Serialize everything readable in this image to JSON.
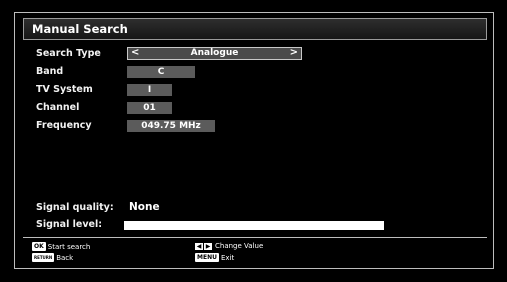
{
  "window": {
    "title": "Manual Search"
  },
  "fields": {
    "search_type": {
      "label": "Search Type",
      "value": "Analogue",
      "left_arrow": "<",
      "right_arrow": ">"
    },
    "band": {
      "label": "Band",
      "value": "C"
    },
    "tv_system": {
      "label": "TV System",
      "value": "I"
    },
    "channel": {
      "label": "Channel",
      "value": "01"
    },
    "frequency": {
      "label": "Frequency",
      "value": "049.75 MHz"
    }
  },
  "signal": {
    "quality_label": "Signal quality:",
    "quality_value": "None",
    "level_label": "Signal level:"
  },
  "footer": {
    "ok_key": "OK",
    "ok_label": "Start search",
    "return_key": "RETURN",
    "return_label": "Back",
    "arrows_label": "Change Value",
    "menu_key": "MENU",
    "menu_label": "Exit"
  },
  "colors": {
    "background": "#000000",
    "value_box": "#5b5b5b",
    "frame_border": "#bdbdbd"
  }
}
